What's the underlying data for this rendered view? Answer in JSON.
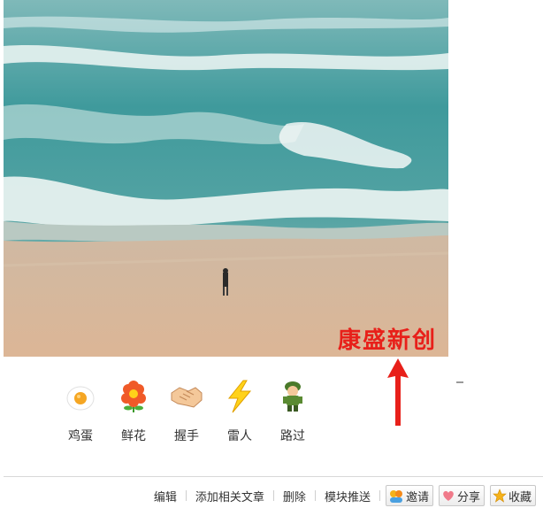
{
  "watermark": "康盛新创",
  "reactions": [
    {
      "label": "鸡蛋",
      "icon": "fried-egg-icon"
    },
    {
      "label": "鲜花",
      "icon": "flower-icon"
    },
    {
      "label": "握手",
      "icon": "handshake-icon"
    },
    {
      "label": "雷人",
      "icon": "lightning-icon"
    },
    {
      "label": "路过",
      "icon": "soldier-icon"
    }
  ],
  "toolbar": {
    "edit": "编辑",
    "add_article": "添加相关文章",
    "delete": "删除",
    "push": "模块推送",
    "invite": "邀请",
    "share": "分享",
    "favorite": "收藏"
  },
  "colors": {
    "watermark": "#e8201a",
    "arrow": "#e8201a"
  }
}
